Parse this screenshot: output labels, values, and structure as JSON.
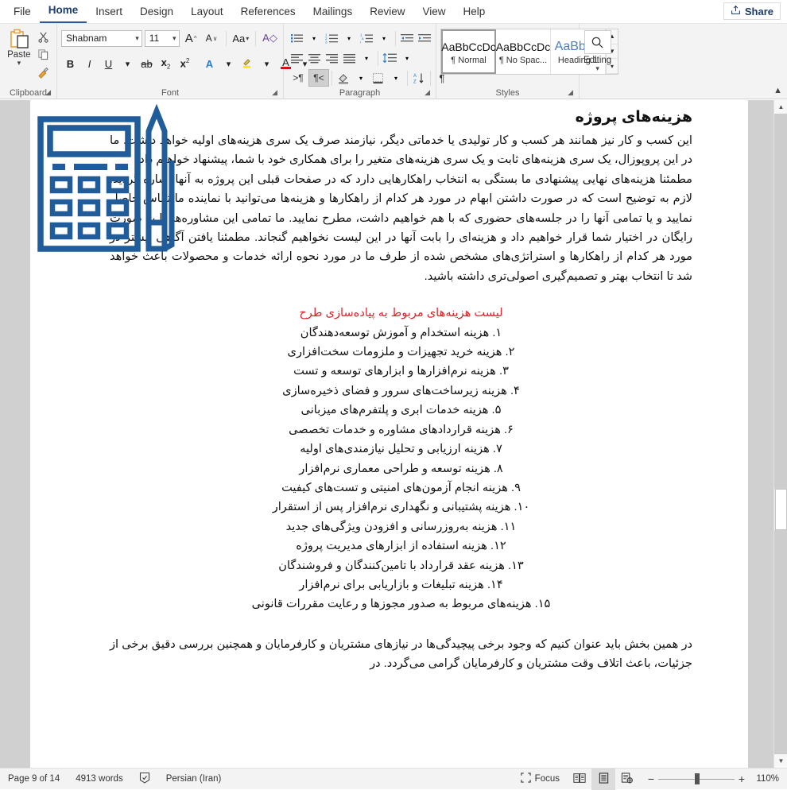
{
  "app": {
    "tabs": [
      {
        "label": "File",
        "active": false
      },
      {
        "label": "Home",
        "active": true
      },
      {
        "label": "Insert",
        "active": false
      },
      {
        "label": "Design",
        "active": false
      },
      {
        "label": "Layout",
        "active": false
      },
      {
        "label": "References",
        "active": false
      },
      {
        "label": "Mailings",
        "active": false
      },
      {
        "label": "Review",
        "active": false
      },
      {
        "label": "View",
        "active": false
      },
      {
        "label": "Help",
        "active": false
      }
    ],
    "share_label": "Share",
    "accent_color": "#2b579a"
  },
  "ribbon": {
    "clipboard": {
      "group_label": "Clipboard",
      "paste_label": "Paste",
      "cut_name": "cut",
      "copy_name": "copy",
      "format_painter_name": "format-painter"
    },
    "font": {
      "group_label": "Font",
      "font_family_value": "Shabnam",
      "font_size_value": "11",
      "grow_font": "A",
      "shrink_font": "A",
      "change_case": "Aa",
      "clear_formatting": "A",
      "bold": "B",
      "italic": "I",
      "underline": "U",
      "strikethrough": "ab",
      "subscript": "x",
      "superscript": "x",
      "text_effects": "A",
      "highlight": "A",
      "font_color": "A"
    },
    "paragraph": {
      "group_label": "Paragraph",
      "buttons": [
        "bullets",
        "numbering",
        "multilevel-list",
        "decrease-indent",
        "increase-indent",
        "align-left",
        "center",
        "align-right",
        "justify",
        "line-spacing",
        "ltr-text-direction",
        "rtl-text-direction",
        "shading",
        "borders",
        "sort",
        "show-formatting-marks"
      ],
      "active_button": "rtl-text-direction"
    },
    "styles": {
      "group_label": "Styles",
      "items": [
        {
          "preview": "AaBbCcDc",
          "name": "¶ Normal",
          "selected": true
        },
        {
          "preview": "AaBbCcDc",
          "name": "¶ No Spac...",
          "selected": false
        },
        {
          "preview": "AaBbCc",
          "name": "Heading 1",
          "selected": false,
          "heading": true
        }
      ]
    },
    "editing": {
      "group_label": "",
      "label": "Editing",
      "icon": "magnifier-icon"
    }
  },
  "document": {
    "title": "هزینه‌های پروژه",
    "paragraph_1": "این کسب و کار نیز همانند هر کسب و کار تولیدی یا خدماتی دیگر، نیازمند صرف یک سری هزینه‌های اولیه خواهد داشت. ما در این پروپوزال، یک سری هزینه‌های ثابت و یک سری هزینه‌های متغیر را برای همکاری خود با شما، پیشنهاد خواهیم داد.",
    "paragraph_2": "مطمئنا هزینه‌های نهایی پیشنهادی ما بستگی به انتخاب راهکارهایی دارد که در صفحات قبلی این پروژه به آنها اشاره گردید. لازم به توضیح است که در صورت داشتن ابهام در مورد هر کدام از راهکارها و هزینه‌ها می‌توانید با نماینده ما تماس حاصل نمایید و یا تمامی آنها را در جلسه‌های حضوری که با هم خواهیم داشت، مطرح نمایید. ما تمامی این مشاوره‌ها را به صورت رایگان در اختیار شما قرار خواهیم داد و هزینه‌ای را بابت آنها در این لیست نخواهیم گنجاند. مطمئنا یافتن آگاهی بیشتر در مورد هر کدام از راهکارها و استراتژی‌های مشخص شده از طرف ما در مورد نحوه ارائه خدمات و محصولات باعث خواهد شد تا انتخاب بهتر و تصمیم‌گیری اصولی‌تری داشته باشید.",
    "red_heading": "لیست هزینه‌های مربوط به پیاده‌سازی طرح",
    "red_heading_color": "#d8262c",
    "cost_list": [
      "۱. هزینه استخدام و آموزش توسعه‌دهندگان",
      "۲. هزینه خرید تجهیزات و ملزومات سخت‌افزاری",
      "۳. هزینه نرم‌افزارها و ابزارهای توسعه و تست",
      "۴. هزینه زیرساخت‌های سرور و فضای ذخیره‌سازی",
      "۵. هزینه خدمات ابری و پلتفرم‌های میزبانی",
      "۶. هزینه قراردادهای مشاوره و خدمات تخصصی",
      "۷. هزینه ارزیابی و تحلیل نیازمندی‌های اولیه",
      "۸. هزینه توسعه و طراحی معماری نرم‌افزار",
      "۹. هزینه انجام آزمون‌های امنیتی و تست‌های کیفیت",
      "۱۰. هزینه پشتیبانی و نگهداری نرم‌افزار پس از استقرار",
      "۱۱. هزینه به‌روزرسانی و افزودن ویژگی‌های جدید",
      "۱۲. هزینه استفاده از ابزارهای مدیریت پروژه",
      "۱۳. هزینه عقد قرارداد با تامین‌کنندگان و فروشندگان",
      "۱۴. هزینه تبلیغات و بازاریابی برای نرم‌افزار",
      "۱۵. هزینه‌های مربوط به صدور مجوزها و رعایت مقررات قانونی"
    ],
    "paragraph_3": "در همین بخش باید عنوان کنیم که وجود برخی پیچیدگی‌ها در نیازهای مشتریان و کارفرمایان و همچنین بررسی دقیق برخی از جزئیات، باعث اتلاف وقت مشتریان و کارفرمایان گرامی می‌گردد. در",
    "image_alt": "calculator-and-pencil-illustration",
    "image_color": "#1f5c99"
  },
  "status": {
    "page_label": "Page 9 of 14",
    "word_count": "4913 words",
    "proofing_icon": "proofing-errors-icon",
    "language": "Persian (Iran)",
    "focus_label": "Focus",
    "view_read": "read-mode-icon",
    "view_print": "print-layout-icon",
    "view_web": "web-layout-icon",
    "zoom_out": "−",
    "zoom_in": "+",
    "zoom_value": "110%"
  }
}
